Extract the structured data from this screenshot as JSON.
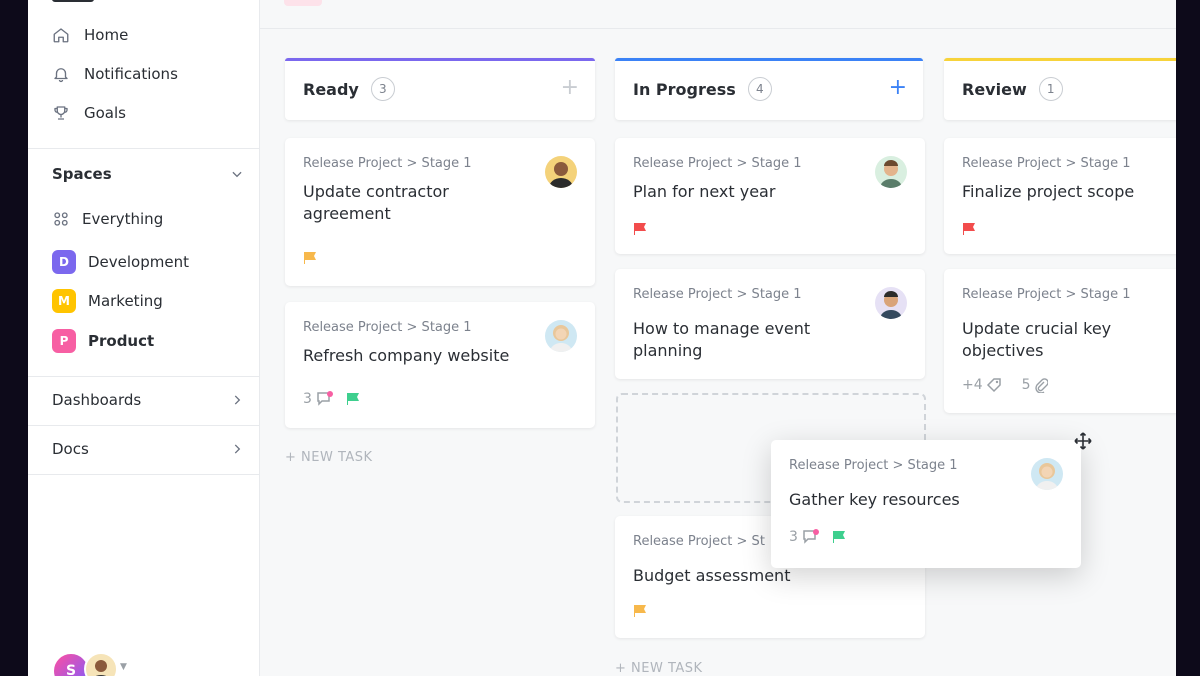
{
  "sidebar": {
    "nav": [
      {
        "label": "Home",
        "icon": "home-icon"
      },
      {
        "label": "Notifications",
        "icon": "bell-icon"
      },
      {
        "label": "Goals",
        "icon": "trophy-icon"
      }
    ],
    "spaces_label": "Spaces",
    "everything_label": "Everything",
    "spaces": [
      {
        "badge": "D",
        "label": "Development",
        "color": "#7b68ee"
      },
      {
        "badge": "M",
        "label": "Marketing",
        "color": "#ffc400"
      },
      {
        "badge": "P",
        "label": "Product",
        "color": "#f75fa3"
      }
    ],
    "dashboards_label": "Dashboards",
    "docs_label": "Docs",
    "user_avatar_letter": "S"
  },
  "board": {
    "columns": [
      {
        "title": "Ready",
        "count": "3",
        "accent": "#7b68ee",
        "add_color": "#c9cdd2"
      },
      {
        "title": "In Progress",
        "count": "4",
        "accent": "#3b82f6",
        "add_color": "#3b82f6"
      },
      {
        "title": "Review",
        "count": "1",
        "accent": "#f7d33b",
        "add_color": "#c9cdd2"
      }
    ],
    "crumb": "Release Project > Stage 1",
    "crumb_cut": "Release Project > St",
    "cards": {
      "update_contractor": {
        "title": "Update contractor agreement",
        "flag": "#f7b84b"
      },
      "refresh_website": {
        "title": "Refresh company website",
        "comments": "3",
        "flag": "#3ecf8e"
      },
      "plan_next_year": {
        "title": "Plan for next year",
        "flag": "#f24c4c"
      },
      "manage_event": {
        "title": "How to manage event planning"
      },
      "budget": {
        "title": "Budget assessment",
        "flag": "#f7b84b"
      },
      "finalize_scope": {
        "title": "Finalize project scope",
        "flag": "#f24c4c"
      },
      "update_objectives": {
        "title": "Update crucial key objectives",
        "tags": "+4",
        "attachments": "5"
      },
      "gather_resources": {
        "title": "Gather key resources",
        "comments": "3",
        "flag": "#3ecf8e"
      }
    },
    "new_task_label": "+ NEW TASK"
  }
}
